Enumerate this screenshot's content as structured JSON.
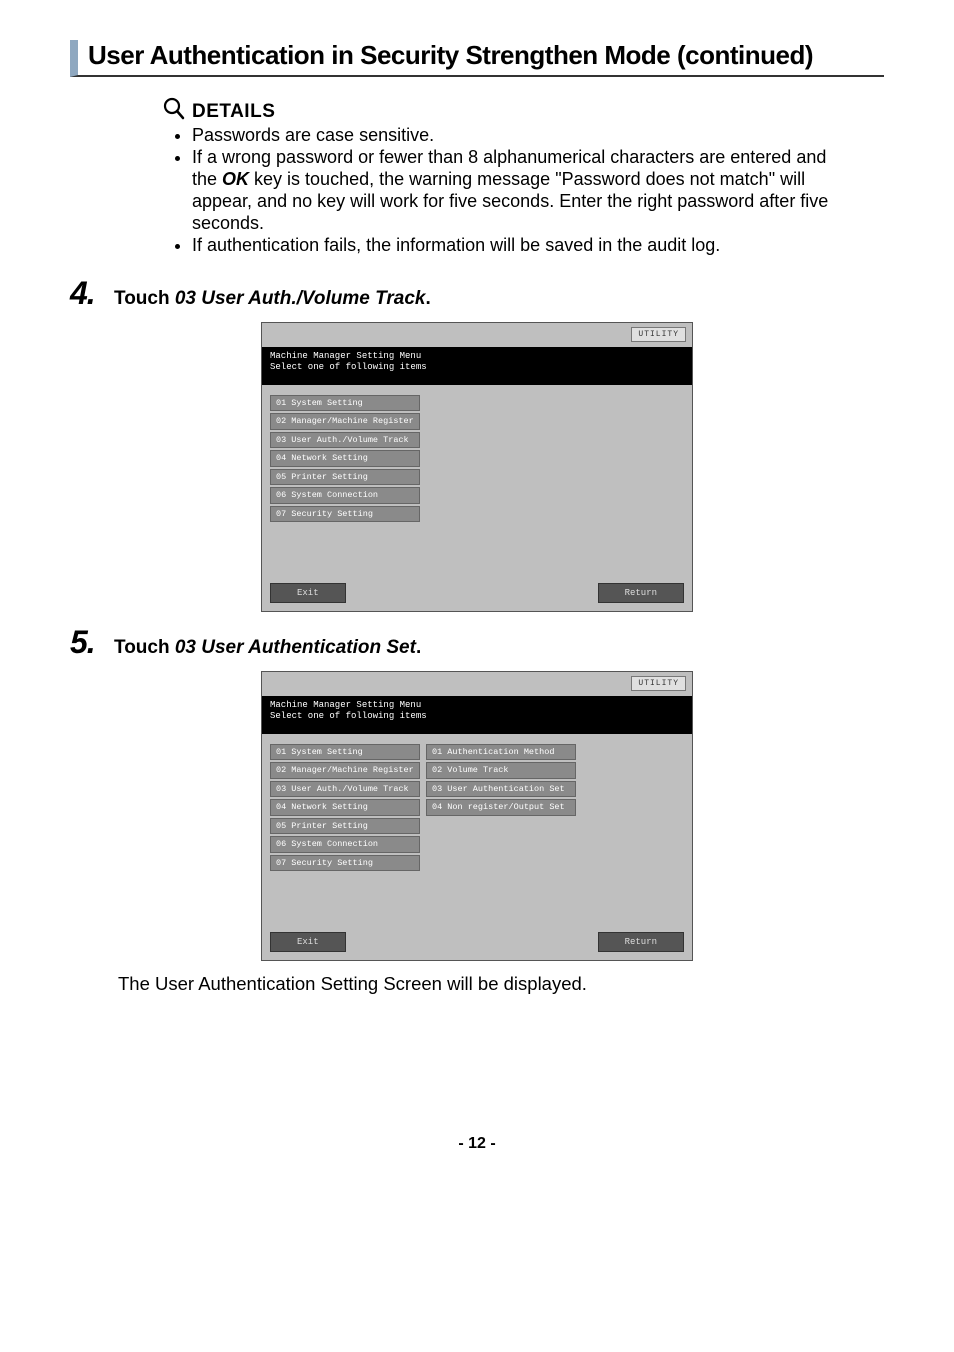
{
  "title": "User Authentication in Security Strengthen Mode (continued)",
  "details": {
    "label": "DETAILS",
    "bullets": {
      "b1": "Passwords are case sensitive.",
      "b2_pre": "If a wrong password or fewer than 8 alphanumerical characters are entered and the ",
      "b2_ok": "OK",
      "b2_post": " key is touched, the warning message \"Password does not match\" will appear, and no key will work for five seconds. Enter the right password after five seconds.",
      "b3": "If authentication fails, the information will be saved in the audit log."
    }
  },
  "step4": {
    "num": "4.",
    "text_pre": "Touch ",
    "text_it": "03 User Auth./Volume Track",
    "text_post": "."
  },
  "step5": {
    "num": "5.",
    "text_pre": "Touch ",
    "text_it": "03 User Authentication Set",
    "text_post": "."
  },
  "closing": "The User Authentication Setting Screen will be displayed.",
  "pagenum": "- 12 -",
  "screen": {
    "utility": "UTILITY",
    "header_l1": "Machine Manager Setting Menu",
    "header_l2": "Select one of following items",
    "left": {
      "i1": "01 System Setting",
      "i2": "02 Manager/Machine Register",
      "i3": "03 User Auth./Volume Track",
      "i4": "04 Network Setting",
      "i5": "05 Printer Setting",
      "i6": "06 System Connection",
      "i7": "07 Security Setting"
    },
    "right": {
      "i1": "01 Authentication Method",
      "i2": "02 Volume Track",
      "i3": "03 User Authentication Set",
      "i4": "04 Non register/Output Set"
    },
    "exit": "Exit",
    "ret": "Return"
  }
}
